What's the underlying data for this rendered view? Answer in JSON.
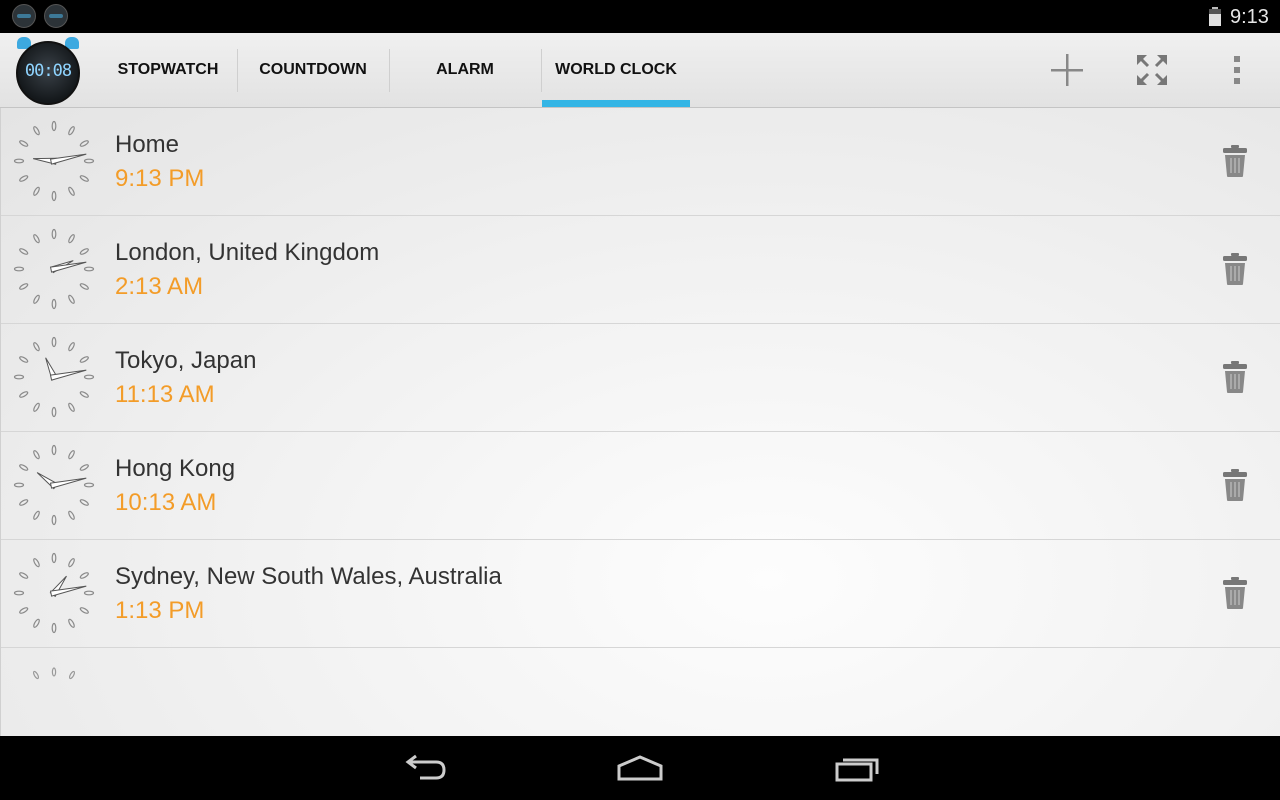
{
  "status_bar": {
    "time": "9:13",
    "icons": [
      "app-notification-icon",
      "app-notification-icon",
      "battery-icon"
    ]
  },
  "action_bar": {
    "app_icon": {
      "name": "stopwatch-app-icon",
      "digits": "00:08"
    },
    "tabs": [
      {
        "label": "STOPWATCH",
        "selected": false
      },
      {
        "label": "COUNTDOWN",
        "selected": false
      },
      {
        "label": "ALARM",
        "selected": false
      },
      {
        "label": "WORLD CLOCK",
        "selected": true
      }
    ],
    "actions": [
      "add-icon",
      "fullscreen-icon",
      "overflow-menu-icon"
    ]
  },
  "clocks": [
    {
      "city": "Home",
      "time": "9:13 PM"
    },
    {
      "city": "London, United Kingdom",
      "time": "2:13 AM"
    },
    {
      "city": "Tokyo, Japan",
      "time": "11:13 AM"
    },
    {
      "city": "Hong Kong",
      "time": "10:13 AM"
    },
    {
      "city": "Sydney, New South Wales, Australia",
      "time": "1:13 PM"
    }
  ],
  "nav_bar": [
    "back-icon",
    "home-icon",
    "recent-apps-icon"
  ],
  "colors": {
    "accent": "#33b5e5",
    "time_text": "#f39c28",
    "city_text": "#333333",
    "system_bar": "#000000"
  }
}
